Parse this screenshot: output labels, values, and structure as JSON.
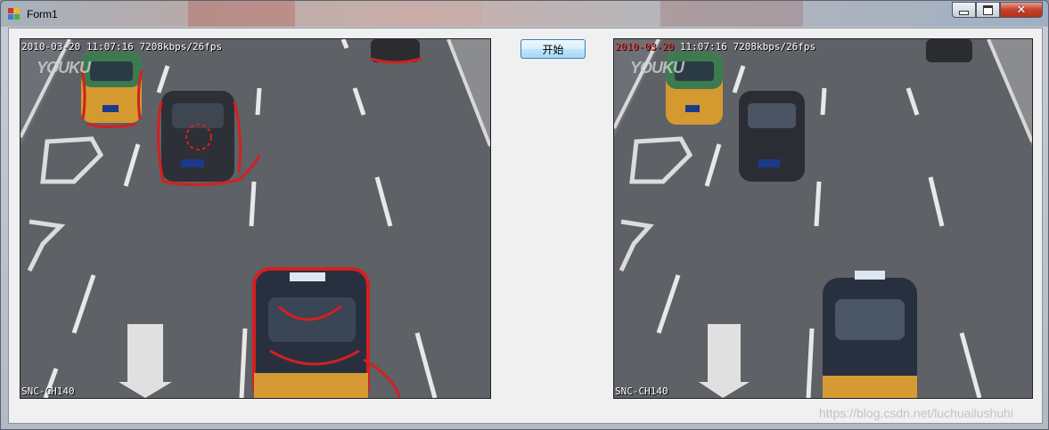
{
  "window": {
    "title": "Form1"
  },
  "toolbar": {
    "start_label": "开始"
  },
  "left_video": {
    "timestamp": "2010-03-20 11:07:16 7208kbps/26fps",
    "camera": "SNC-CH140",
    "logo": "YOUKU"
  },
  "right_video": {
    "timestamp_red": "2010-03-20",
    "timestamp_rest": " 11:07:16 7208kbps/26fps",
    "camera": "SNC-CH140",
    "logo": "YOUKU"
  },
  "watermark": "https://blog.csdn.net/luchuailushuhi",
  "colors": {
    "detection": "#d42020",
    "taxi_green": "#3d7a4f",
    "taxi_yellow": "#e0a020",
    "road": "#5e6166"
  },
  "icons": {
    "app": "form-icon",
    "minimize": "minimize-icon",
    "maximize": "maximize-icon",
    "close": "close-icon"
  }
}
